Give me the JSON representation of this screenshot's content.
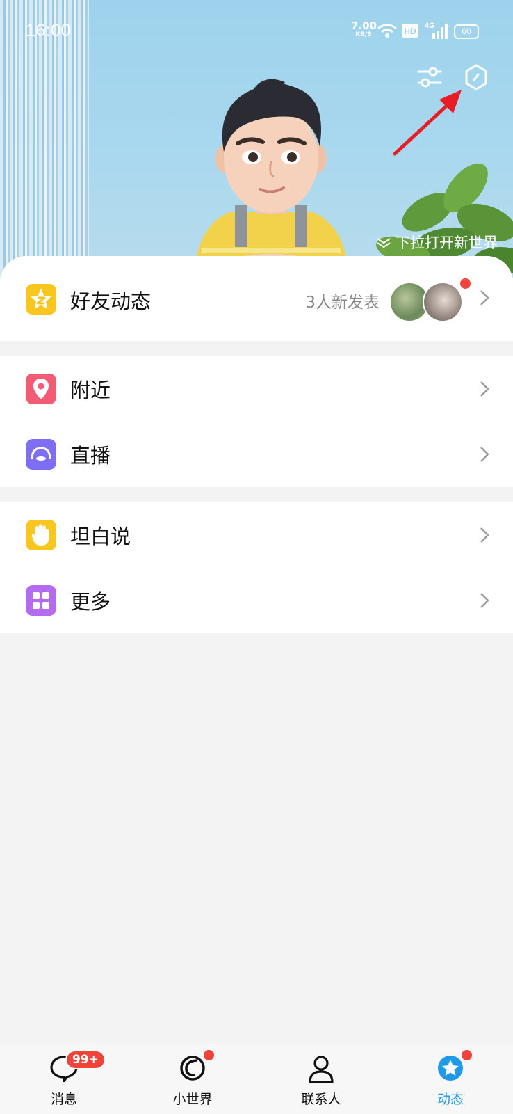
{
  "status_bar": {
    "time": "16:00",
    "net_speed_value": "7.00",
    "net_speed_unit": "KB/S",
    "network": "4G",
    "battery": "60"
  },
  "header": {
    "scroll_hint": "下拉打开新世界"
  },
  "friends_row": {
    "label": "好友动态",
    "subtitle": "3人新发表"
  },
  "menu_group_1": [
    {
      "label": "附近"
    },
    {
      "label": "直播"
    }
  ],
  "menu_group_2": [
    {
      "label": "坦白说"
    },
    {
      "label": "更多"
    }
  ],
  "bottom_nav": {
    "tabs": [
      {
        "label": "消息",
        "badge": "99+"
      },
      {
        "label": "小世界"
      },
      {
        "label": "联系人"
      },
      {
        "label": "动态"
      }
    ]
  },
  "colors": {
    "accent": "#1e9ae8",
    "badge_red": "#f0433a",
    "friends_icon": "#f9c51f",
    "nearby_icon": "#f35a74",
    "live_icon": "#7e6ef4",
    "confess_icon": "#f9c51f",
    "more_icon": "#b36cf0",
    "annotation_arrow": "#e81c24"
  }
}
